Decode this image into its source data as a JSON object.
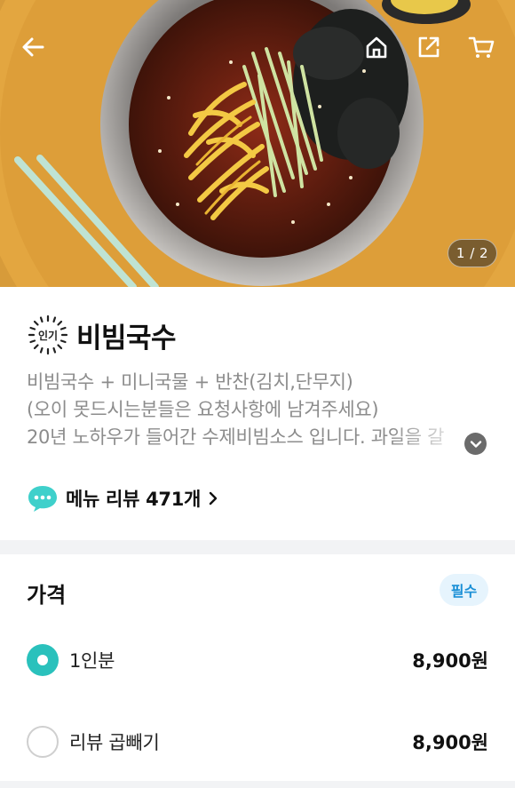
{
  "hero": {
    "image_alt": "비빔국수",
    "counter": "1 / 2",
    "buttons": {
      "back": "arrow-left-icon",
      "home": "home-icon",
      "share": "share-icon",
      "cart": "cart-icon"
    }
  },
  "menu": {
    "badge": "인기",
    "title": "비빔국수",
    "description": [
      "비빔국수 + 미니국물 + 반찬(김치,단무지)",
      "(오이 못드시는분들은 요청사항에 남겨주세요)",
      "20년 노하우가 들어간 수제비빔소스 입니다. 과일을 갈"
    ],
    "review_link": "메뉴 리뷰 471개"
  },
  "price": {
    "header": "가격",
    "required_badge": "필수",
    "options": [
      {
        "label": "1인분",
        "price": "8,900원",
        "selected": true
      },
      {
        "label": "리뷰 곱빼기",
        "price": "8,900원",
        "selected": false
      }
    ]
  },
  "colors": {
    "accent": "#2ac1bc",
    "required_text": "#1a8fd6",
    "required_bg": "#e6f4fd"
  }
}
